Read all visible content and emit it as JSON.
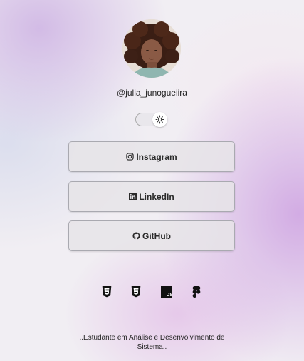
{
  "profile": {
    "username": "@julia_junogueiira"
  },
  "links": [
    {
      "label": "Instagram",
      "icon": "instagram-icon"
    },
    {
      "label": "LinkedIn",
      "icon": "linkedin-icon"
    },
    {
      "label": "GitHub",
      "icon": "github-icon"
    }
  ],
  "tech_icons": [
    "html5-icon",
    "css3-icon",
    "javascript-icon",
    "figma-icon"
  ],
  "footer": {
    "line1": "..Estudante em Análise e Desenvolvimento de",
    "line2": "Sistema.."
  }
}
